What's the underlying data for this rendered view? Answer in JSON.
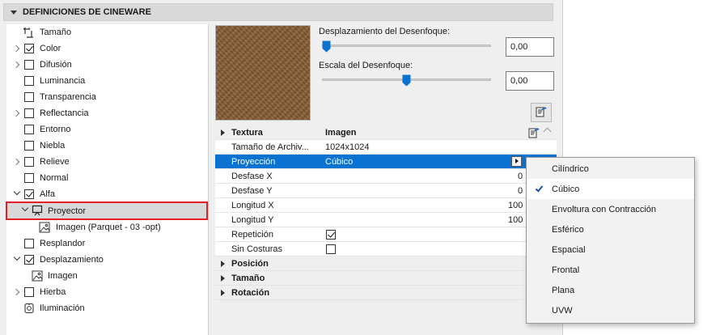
{
  "section": {
    "title": "DEFINICIONES DE CINEWARE"
  },
  "tree": {
    "items": [
      {
        "label": "Tamaño",
        "icon": "size-icon",
        "checkbox": null,
        "expand": null
      },
      {
        "label": "Color",
        "checkbox": true,
        "expand": "collapsed"
      },
      {
        "label": "Difusión",
        "checkbox": false,
        "expand": "collapsed"
      },
      {
        "label": "Luminancia",
        "checkbox": false,
        "expand": null
      },
      {
        "label": "Transparencia",
        "checkbox": false,
        "expand": null
      },
      {
        "label": "Reflectancia",
        "checkbox": false,
        "expand": "collapsed"
      },
      {
        "label": "Entorno",
        "checkbox": false,
        "expand": null
      },
      {
        "label": "Niebla",
        "checkbox": false,
        "expand": null
      },
      {
        "label": "Relieve",
        "checkbox": false,
        "expand": "collapsed"
      },
      {
        "label": "Normal",
        "checkbox": false,
        "expand": null
      },
      {
        "label": "Alfa",
        "checkbox": true,
        "expand": "expanded"
      },
      {
        "label": "Proyector",
        "icon": "projector-icon",
        "checkbox": null,
        "expand": "expanded",
        "selected": true
      },
      {
        "label": "Imagen (Parquet - 03 -opt)",
        "icon": "image-icon",
        "checkbox": null,
        "expand": null
      },
      {
        "label": "Resplandor",
        "checkbox": false,
        "expand": null
      },
      {
        "label": "Desplazamiento",
        "checkbox": true,
        "expand": "expanded"
      },
      {
        "label": "Imagen",
        "icon": "image-icon",
        "checkbox": null,
        "expand": null
      },
      {
        "label": "Hierba",
        "checkbox": false,
        "expand": "collapsed"
      },
      {
        "label": "Iluminación",
        "icon": "lighting-icon",
        "checkbox": null,
        "expand": null
      }
    ]
  },
  "blur": {
    "offset_label": "Desplazamiento del Desenfoque:",
    "offset_value": "0,00",
    "offset_fraction": 0.0,
    "scale_label": "Escala del Desenfoque:",
    "scale_value": "0,00",
    "scale_fraction": 0.5
  },
  "properties": {
    "texture_group": {
      "name": "Textura",
      "value": "Imagen"
    },
    "rows": [
      {
        "name": "Tamaño de Archiv...",
        "value": "1024x1024"
      },
      {
        "name": "Proyección",
        "value": "Cúbico",
        "selected": true
      },
      {
        "name": "Desfase X",
        "value": "0"
      },
      {
        "name": "Desfase Y",
        "value": "0"
      },
      {
        "name": "Longitud X",
        "value": "100"
      },
      {
        "name": "Longitud Y",
        "value": "100"
      },
      {
        "name": "Repetición",
        "checkbox": true
      },
      {
        "name": "Sin Costuras",
        "checkbox": false
      }
    ],
    "groups": [
      "Posición",
      "Tamaño",
      "Rotación"
    ]
  },
  "projection_menu": {
    "options": [
      "Cilíndrico",
      "Cúbico",
      "Envoltura con Contracción",
      "Esférico",
      "Espacial",
      "Frontal",
      "Plana",
      "UVW"
    ],
    "selected": "Cúbico"
  },
  "colors": {
    "accent": "#0a73d1",
    "highlight_border": "#e32027",
    "swatch": "#8b6236"
  }
}
